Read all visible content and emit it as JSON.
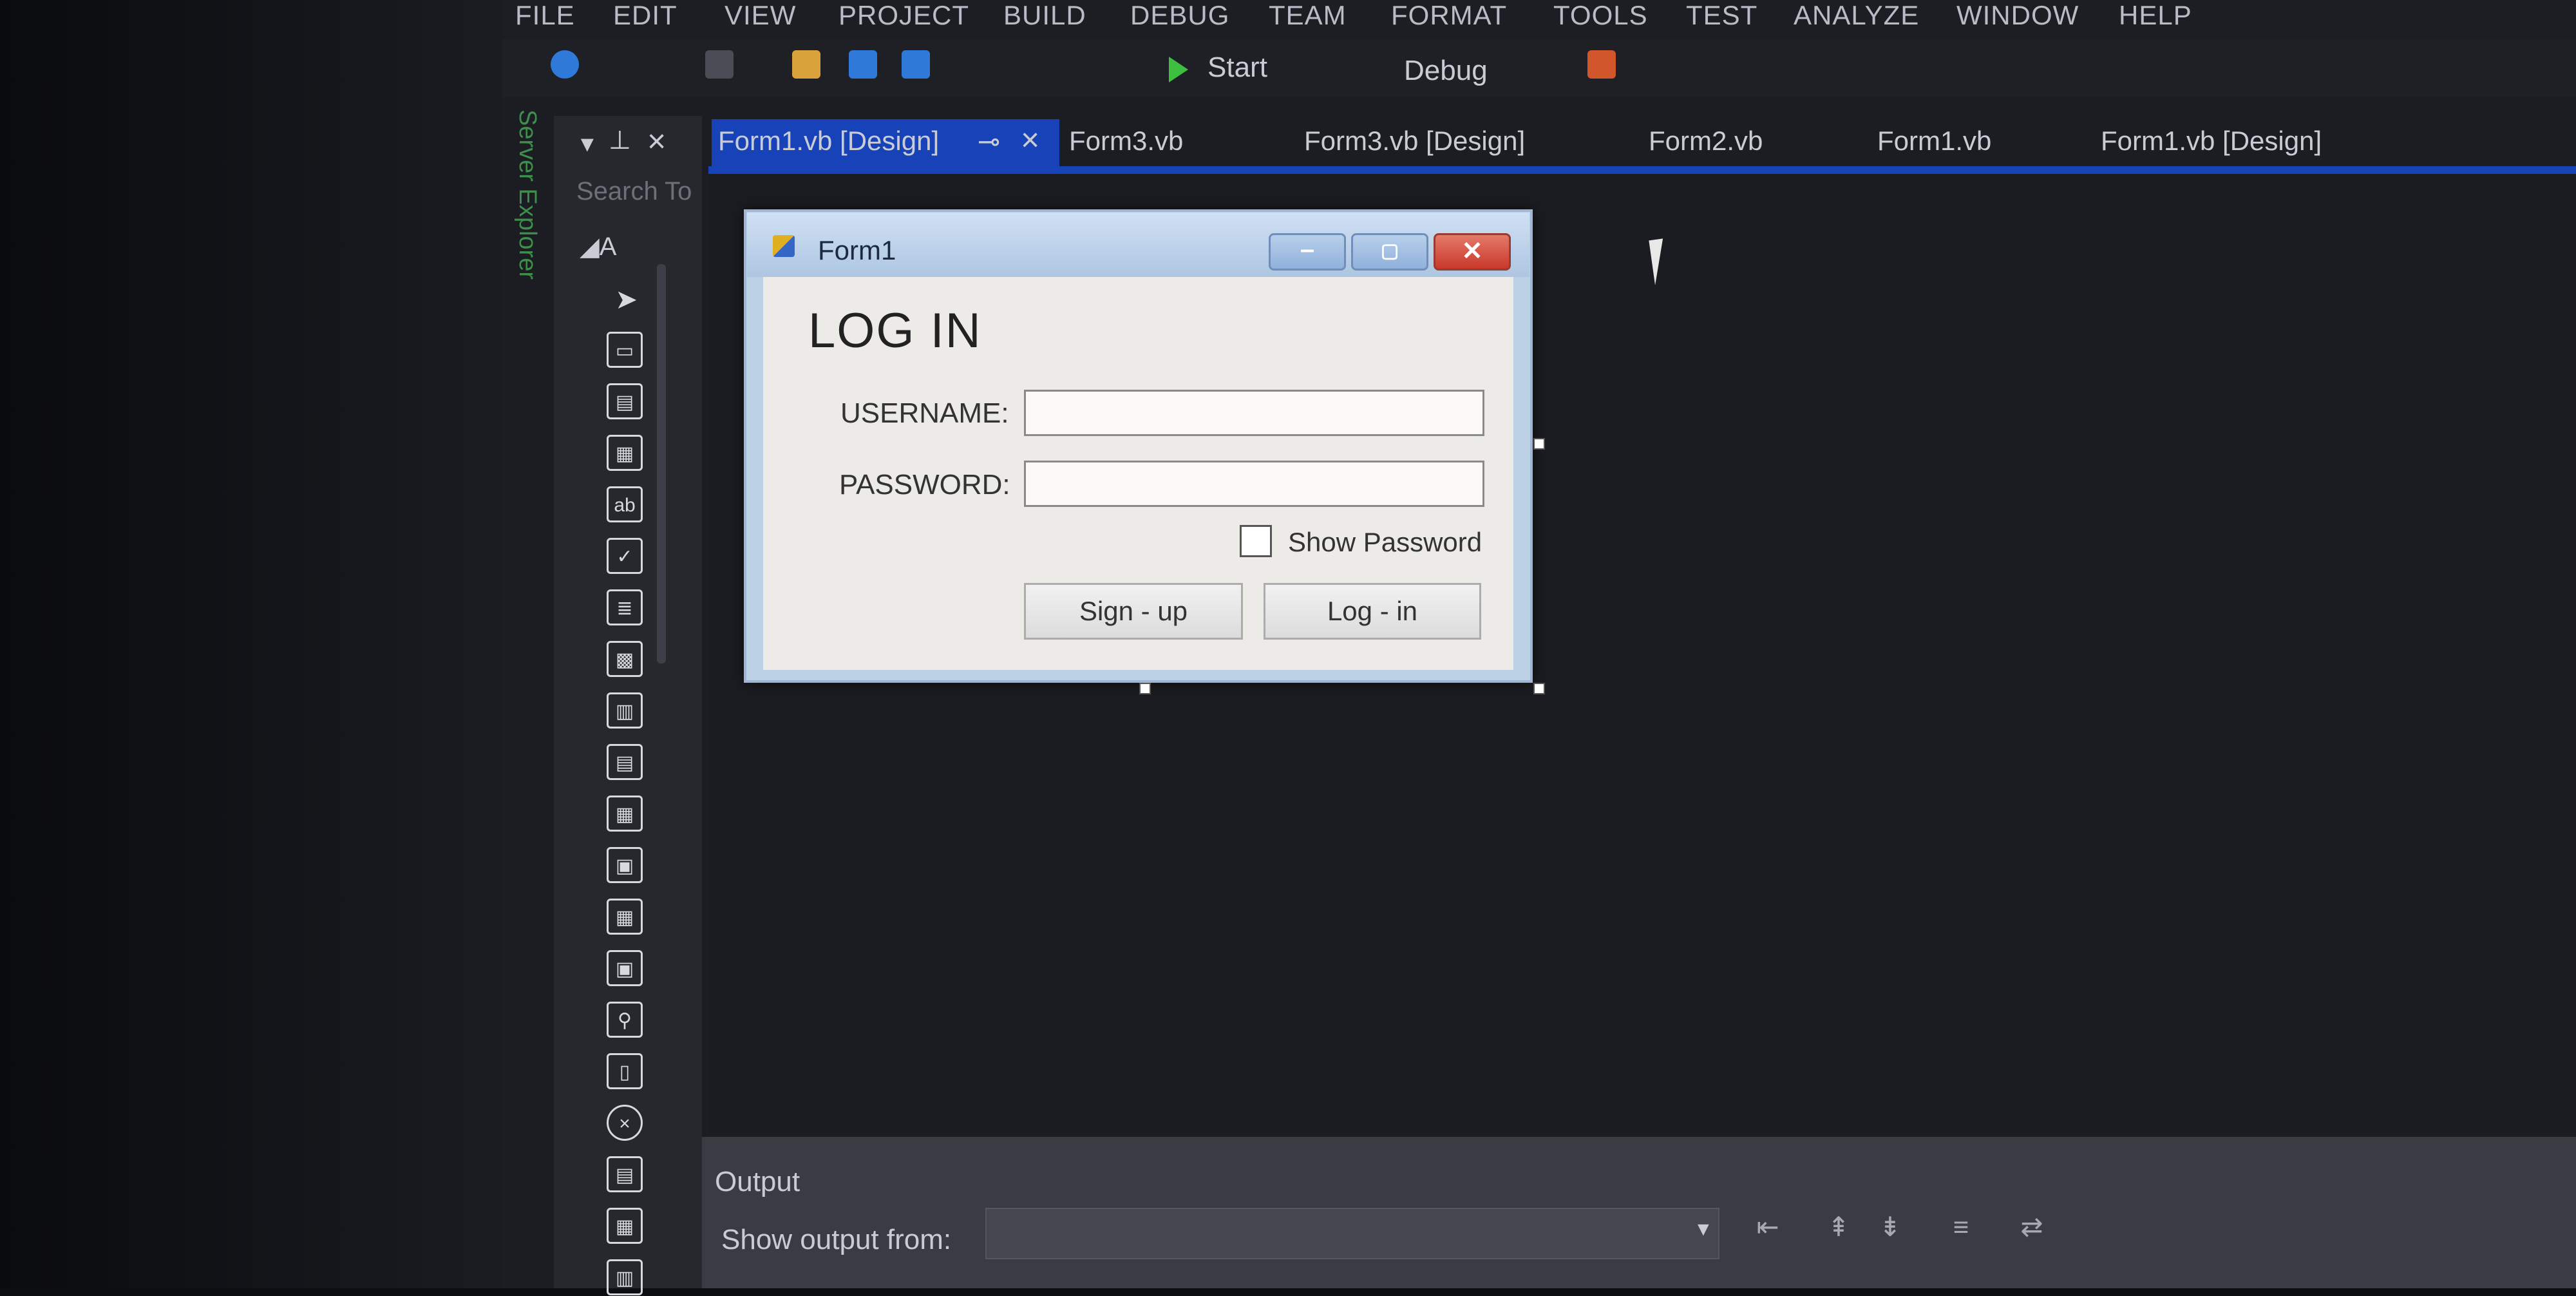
{
  "menu": [
    "FILE",
    "EDIT",
    "VIEW",
    "PROJECT",
    "BUILD",
    "DEBUG",
    "TEAM",
    "FORMAT",
    "TOOLS",
    "TEST",
    "ANALYZE",
    "WINDOW",
    "HELP"
  ],
  "toolbar": {
    "start_label": "Start",
    "config_label": "Debug"
  },
  "side_panel": {
    "server_explorer_label": "Server Explorer",
    "search_placeholder": "Search To",
    "group_label": "A"
  },
  "tabs": [
    "Form1.vb [Design]",
    "Form3.vb",
    "Form3.vb [Design]",
    "Form2.vb",
    "Form1.vb",
    "Form1.vb [Design]"
  ],
  "form": {
    "title": "Form1",
    "heading": "LOG IN",
    "username_label": "USERNAME:",
    "password_label": "PASSWORD:",
    "show_password_label": "Show Password",
    "signup_label": "Sign - up",
    "login_label": "Log - in"
  },
  "output": {
    "title": "Output",
    "show_output_from": "Show output from:"
  },
  "colors": {
    "accent": "#1742b8",
    "start_green": "#3fbf3f",
    "close_red": "#c8382a"
  }
}
